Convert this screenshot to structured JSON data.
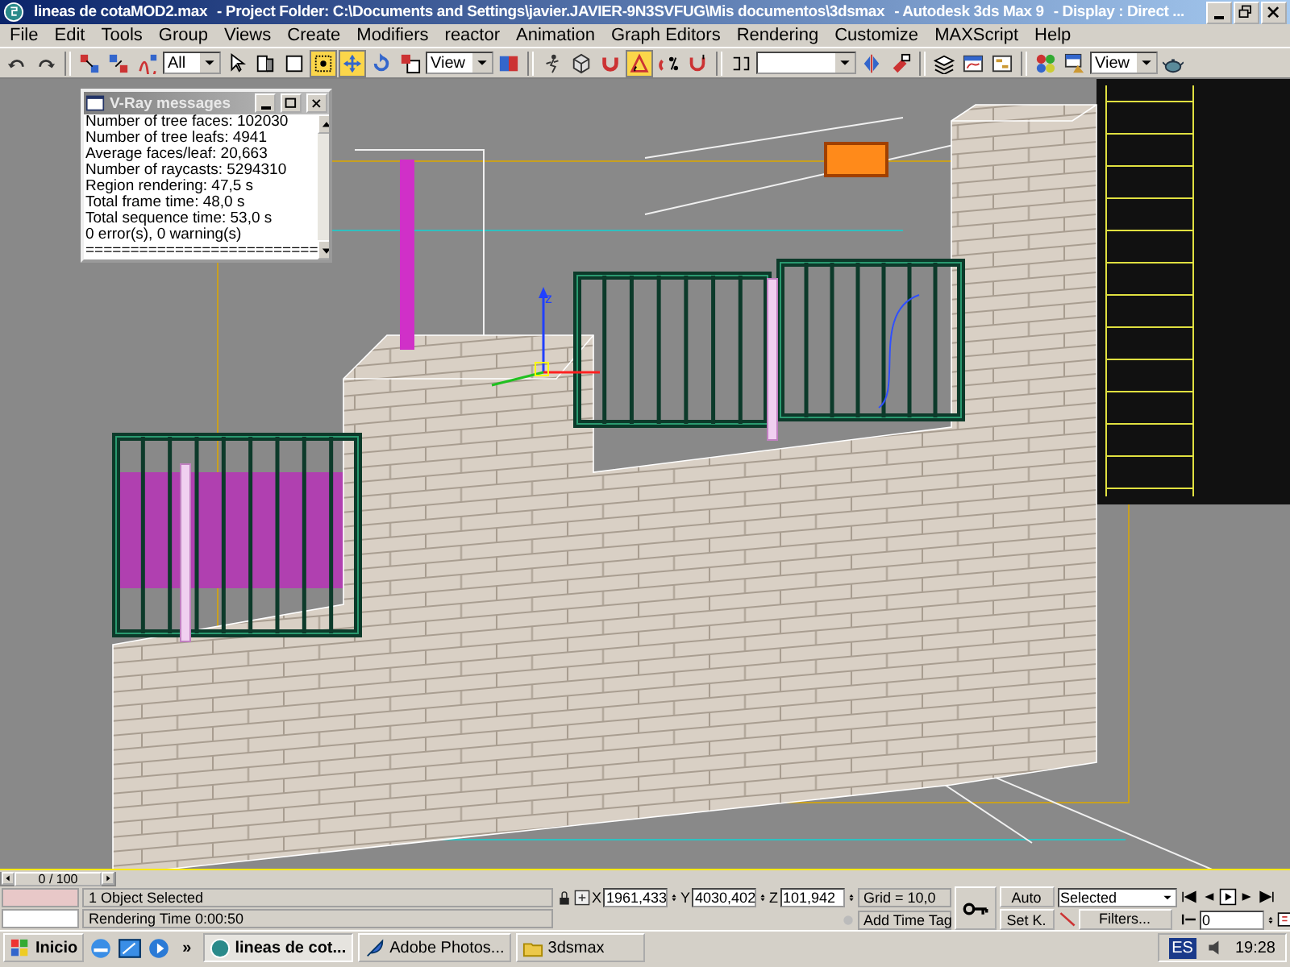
{
  "title_bar": {
    "parts": [
      "lineas de cotaMOD2.max",
      "- Project Folder: C:\\Documents and Settings\\javier.JAVIER-9N3SVFUG\\Mis documentos\\3dsmax",
      "- Autodesk 3ds Max 9",
      "- Display : Direct ..."
    ]
  },
  "menu": [
    "File",
    "Edit",
    "Tools",
    "Group",
    "Views",
    "Create",
    "Modifiers",
    "reactor",
    "Animation",
    "Graph Editors",
    "Rendering",
    "Customize",
    "MAXScript",
    "Help"
  ],
  "toolbar": [
    {
      "kind": "icon",
      "selected": false
    },
    {
      "kind": "icon",
      "selected": false
    },
    {
      "kind": "separator"
    },
    {
      "kind": "icon",
      "selected": false
    },
    {
      "kind": "icon",
      "selected": false
    },
    {
      "kind": "icon",
      "selected": false
    },
    {
      "kind": "dropdown",
      "value": "All"
    },
    {
      "kind": "icon",
      "selected": false
    },
    {
      "kind": "icon",
      "selected": false
    },
    {
      "kind": "icon",
      "selected": false
    },
    {
      "kind": "icon",
      "selected": true
    },
    {
      "kind": "icon",
      "selected": true
    },
    {
      "kind": "icon",
      "selected": false
    },
    {
      "kind": "icon",
      "selected": false
    },
    {
      "kind": "dropdown",
      "value": "View"
    },
    {
      "kind": "icon",
      "selected": false
    },
    {
      "kind": "separator"
    },
    {
      "kind": "icon",
      "selected": false
    },
    {
      "kind": "icon",
      "selected": false
    },
    {
      "kind": "icon",
      "selected": false
    },
    {
      "kind": "icon",
      "selected": true
    },
    {
      "kind": "icon",
      "selected": false
    },
    {
      "kind": "icon",
      "selected": false
    },
    {
      "kind": "separator"
    },
    {
      "kind": "icon",
      "selected": false
    },
    {
      "kind": "dropdown"
    },
    {
      "kind": "icon",
      "selected": false
    },
    {
      "kind": "icon",
      "selected": false
    },
    {
      "kind": "separator"
    },
    {
      "kind": "icon",
      "selected": false
    },
    {
      "kind": "icon",
      "selected": false
    },
    {
      "kind": "icon",
      "selected": false
    },
    {
      "kind": "separator"
    },
    {
      "kind": "icon",
      "selected": false
    },
    {
      "kind": "icon",
      "selected": false
    },
    {
      "kind": "dropdown",
      "value": "View"
    },
    {
      "kind": "icon",
      "selected": false
    }
  ],
  "viewport": {
    "gizmo_label": "z"
  },
  "vray_window": {
    "title": "V-Ray messages",
    "lines": [
      "Number of tree faces: 102030",
      "Number of tree leafs: 4941",
      "Average faces/leaf: 20,663",
      "Number of raycasts: 5294310",
      "Region rendering: 47,5 s",
      "Total frame time: 48,0 s",
      "Total sequence time: 53,0 s",
      "0 error(s), 0 warning(s)",
      "=========================="
    ]
  },
  "time_slider": {
    "label": "0 / 100"
  },
  "status": {
    "prompt": "1 Object Selected",
    "info": "Rendering Time  0:00:50",
    "coordinates": [
      {
        "axis": "X",
        "value": "1961,433"
      },
      {
        "axis": "Y",
        "value": "4030,402"
      },
      {
        "axis": "Z",
        "value": "101,942"
      }
    ],
    "grid": "Grid = 10,0",
    "time_tag": "Add Time Tag",
    "auto_key": "Auto",
    "set_key": "Set K.",
    "key_filter": "Selected",
    "filters": "Filters...",
    "frame": "0"
  },
  "taskbar": {
    "start": "Inicio",
    "more": "»",
    "tasks": [
      {
        "label": "lineas de cot...",
        "selected": true
      },
      {
        "label": "Adobe Photos...",
        "selected": false
      },
      {
        "label": "3dsmax",
        "selected": false
      }
    ],
    "language": "ES",
    "clock": "19:28"
  }
}
